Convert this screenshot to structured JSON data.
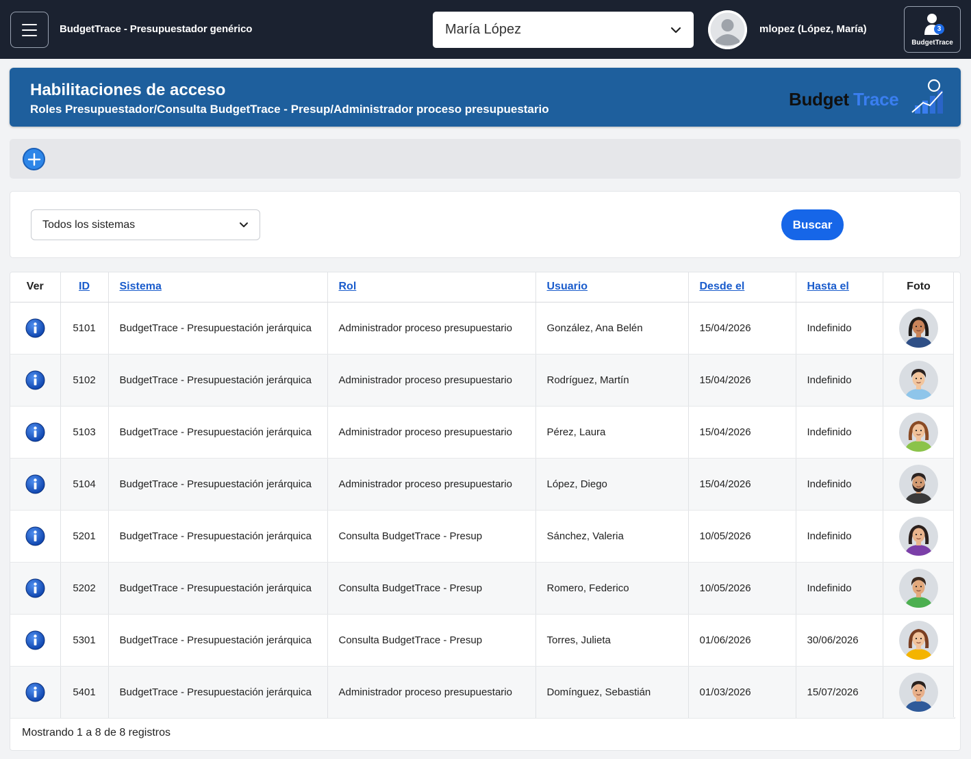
{
  "app": {
    "title": "BudgetTrace - Presupuestador genérico",
    "selected_person": "María López",
    "user_label": "mlopez (López, María)",
    "badge_label": "BudgetTrace",
    "badge_count": "3"
  },
  "banner": {
    "title": "Habilitaciones de acceso",
    "subtitle": "Roles  Presupuestador/Consulta BudgetTrace - Presup/Administrador proceso presupuestario",
    "logo_part1": "Budget",
    "logo_part2": "Trace"
  },
  "filter": {
    "system_value": "Todos los sistemas",
    "search_label": "Buscar"
  },
  "table": {
    "headers": {
      "ver": "Ver",
      "id": "ID",
      "sistema": "Sistema",
      "rol": "Rol",
      "usuario": "Usuario",
      "desde": "Desde el",
      "hasta": "Hasta el",
      "foto": "Foto"
    },
    "rows": [
      {
        "id": "5101",
        "sistema": "BudgetTrace - Presupuestación jerárquica",
        "rol": "Administrador proceso presupuestario",
        "usuario": "González, Ana Belén",
        "desde": "15/04/2026",
        "hasta": "Indefinido",
        "avatar": {
          "skin": "#c9845a",
          "hair": "#1e1a18",
          "shirt": "#2f4f86",
          "style": "long"
        }
      },
      {
        "id": "5102",
        "sistema": "BudgetTrace - Presupuestación jerárquica",
        "rol": "Administrador proceso presupuestario",
        "usuario": "Rodríguez, Martín",
        "desde": "15/04/2026",
        "hasta": "Indefinido",
        "avatar": {
          "skin": "#f2c59d",
          "hair": "#2a2220",
          "shirt": "#8ec5ea",
          "style": "short"
        }
      },
      {
        "id": "5103",
        "sistema": "BudgetTrace - Presupuestación jerárquica",
        "rol": "Administrador proceso presupuestario",
        "usuario": "Pérez, Laura",
        "desde": "15/04/2026",
        "hasta": "Indefinido",
        "avatar": {
          "skin": "#f0c29a",
          "hair": "#8a4b25",
          "shirt": "#8bc34a",
          "style": "long"
        }
      },
      {
        "id": "5104",
        "sistema": "BudgetTrace - Presupuestación jerárquica",
        "rol": "Administrador proceso presupuestario",
        "usuario": "López, Diego",
        "desde": "15/04/2026",
        "hasta": "Indefinido",
        "avatar": {
          "skin": "#d29b73",
          "hair": "#2b2321",
          "shirt": "#3a3a3a",
          "style": "beard"
        }
      },
      {
        "id": "5201",
        "sistema": "BudgetTrace - Presupuestación jerárquica",
        "rol": "Consulta BudgetTrace - Presup",
        "usuario": "Sánchez, Valeria",
        "desde": "10/05/2026",
        "hasta": "Indefinido",
        "avatar": {
          "skin": "#e9b48d",
          "hair": "#2a1f1c",
          "shirt": "#7b3fa8",
          "style": "long"
        }
      },
      {
        "id": "5202",
        "sistema": "BudgetTrace - Presupuestación jerárquica",
        "rol": "Consulta BudgetTrace - Presup",
        "usuario": "Romero, Federico",
        "desde": "10/05/2026",
        "hasta": "Indefinido",
        "avatar": {
          "skin": "#e3a97c",
          "hair": "#3b2a20",
          "shirt": "#4caf50",
          "style": "short"
        }
      },
      {
        "id": "5301",
        "sistema": "BudgetTrace - Presupuestación jerárquica",
        "rol": "Consulta BudgetTrace - Presup",
        "usuario": "Torres, Julieta",
        "desde": "01/06/2026",
        "hasta": "30/06/2026",
        "avatar": {
          "skin": "#f1c39c",
          "hair": "#7a3f22",
          "shirt": "#f4b400",
          "style": "long"
        }
      },
      {
        "id": "5401",
        "sistema": "BudgetTrace - Presupuestación jerárquica",
        "rol": "Administrador proceso presupuestario",
        "usuario": "Domínguez, Sebastián",
        "desde": "01/03/2026",
        "hasta": "15/07/2026",
        "avatar": {
          "skin": "#e8b08a",
          "hair": "#2a211d",
          "shirt": "#2f5a9a",
          "style": "short"
        }
      }
    ],
    "footer": "Mostrando 1 a 8 de 8 registros"
  },
  "colors": {
    "topbar": "#1b2230",
    "banner": "#1e5f9d",
    "primary_button": "#1666e8",
    "link": "#1a5ccc"
  }
}
